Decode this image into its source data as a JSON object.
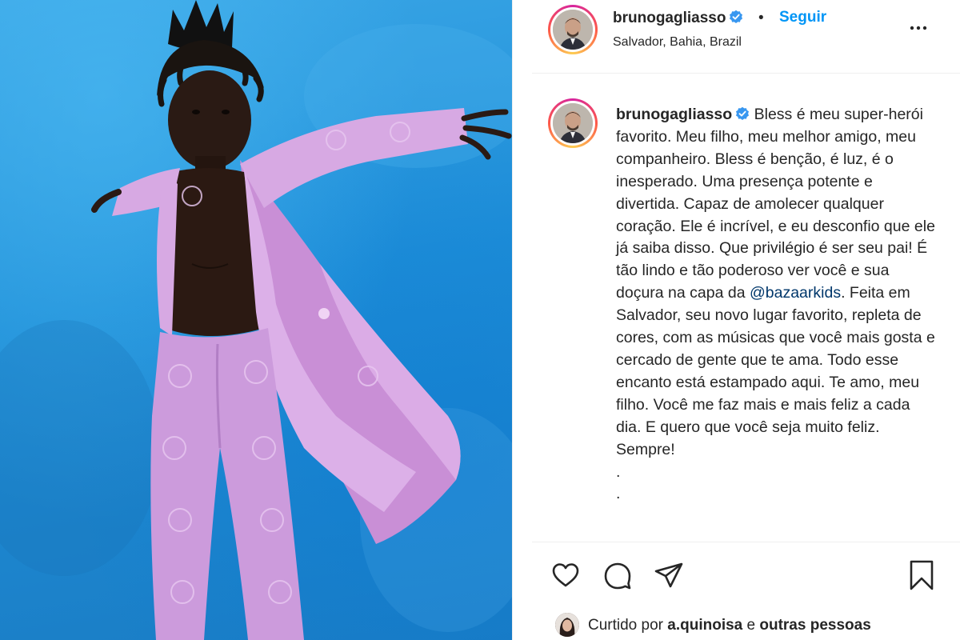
{
  "post": {
    "username": "brunogagliasso",
    "follow_label": "Seguir",
    "separator": "•",
    "location": "Salvador, Bahia, Brazil",
    "caption_username": "brunogagliasso",
    "caption_before_mention": "Bless é meu super-herói favorito. Meu filho, meu melhor amigo, meu companheiro. Bless é benção, é luz, é o inesperado. Uma presença potente e divertida. Capaz de amolecer qualquer coração. Ele é incrível, e eu desconfio que ele já saiba disso. Que privilégio é ser seu pai! É tão lindo e tão poderoso ver você e sua doçura na capa da ",
    "caption_mention": "@bazaarkids",
    "caption_after_mention": ". Feita em Salvador, seu novo lugar favorito, repleta de cores, com as músicas que você mais gosta e cercado de gente que te ama. Todo esse encanto está estampado aqui. Te amo, meu filho. Você me faz mais e mais feliz a cada dia. E quero que você seja muito feliz. Sempre!\n.\n.",
    "likes": {
      "prefix": "Curtido por ",
      "user": "a.quinoisa",
      "middle": " e ",
      "others": "outras pessoas"
    }
  },
  "icons": {
    "verified": "verified-badge-icon",
    "more": "more-options-icon",
    "like": "heart-icon",
    "comment": "comment-bubble-icon",
    "share": "paper-plane-icon",
    "save": "bookmark-icon"
  },
  "colors": {
    "follow_blue": "#0095f6",
    "mention_blue": "#00376b",
    "verified_blue": "#3897f0",
    "photo_background": "#1f8fd8",
    "outfit_lilac": "#d7a9e3"
  }
}
